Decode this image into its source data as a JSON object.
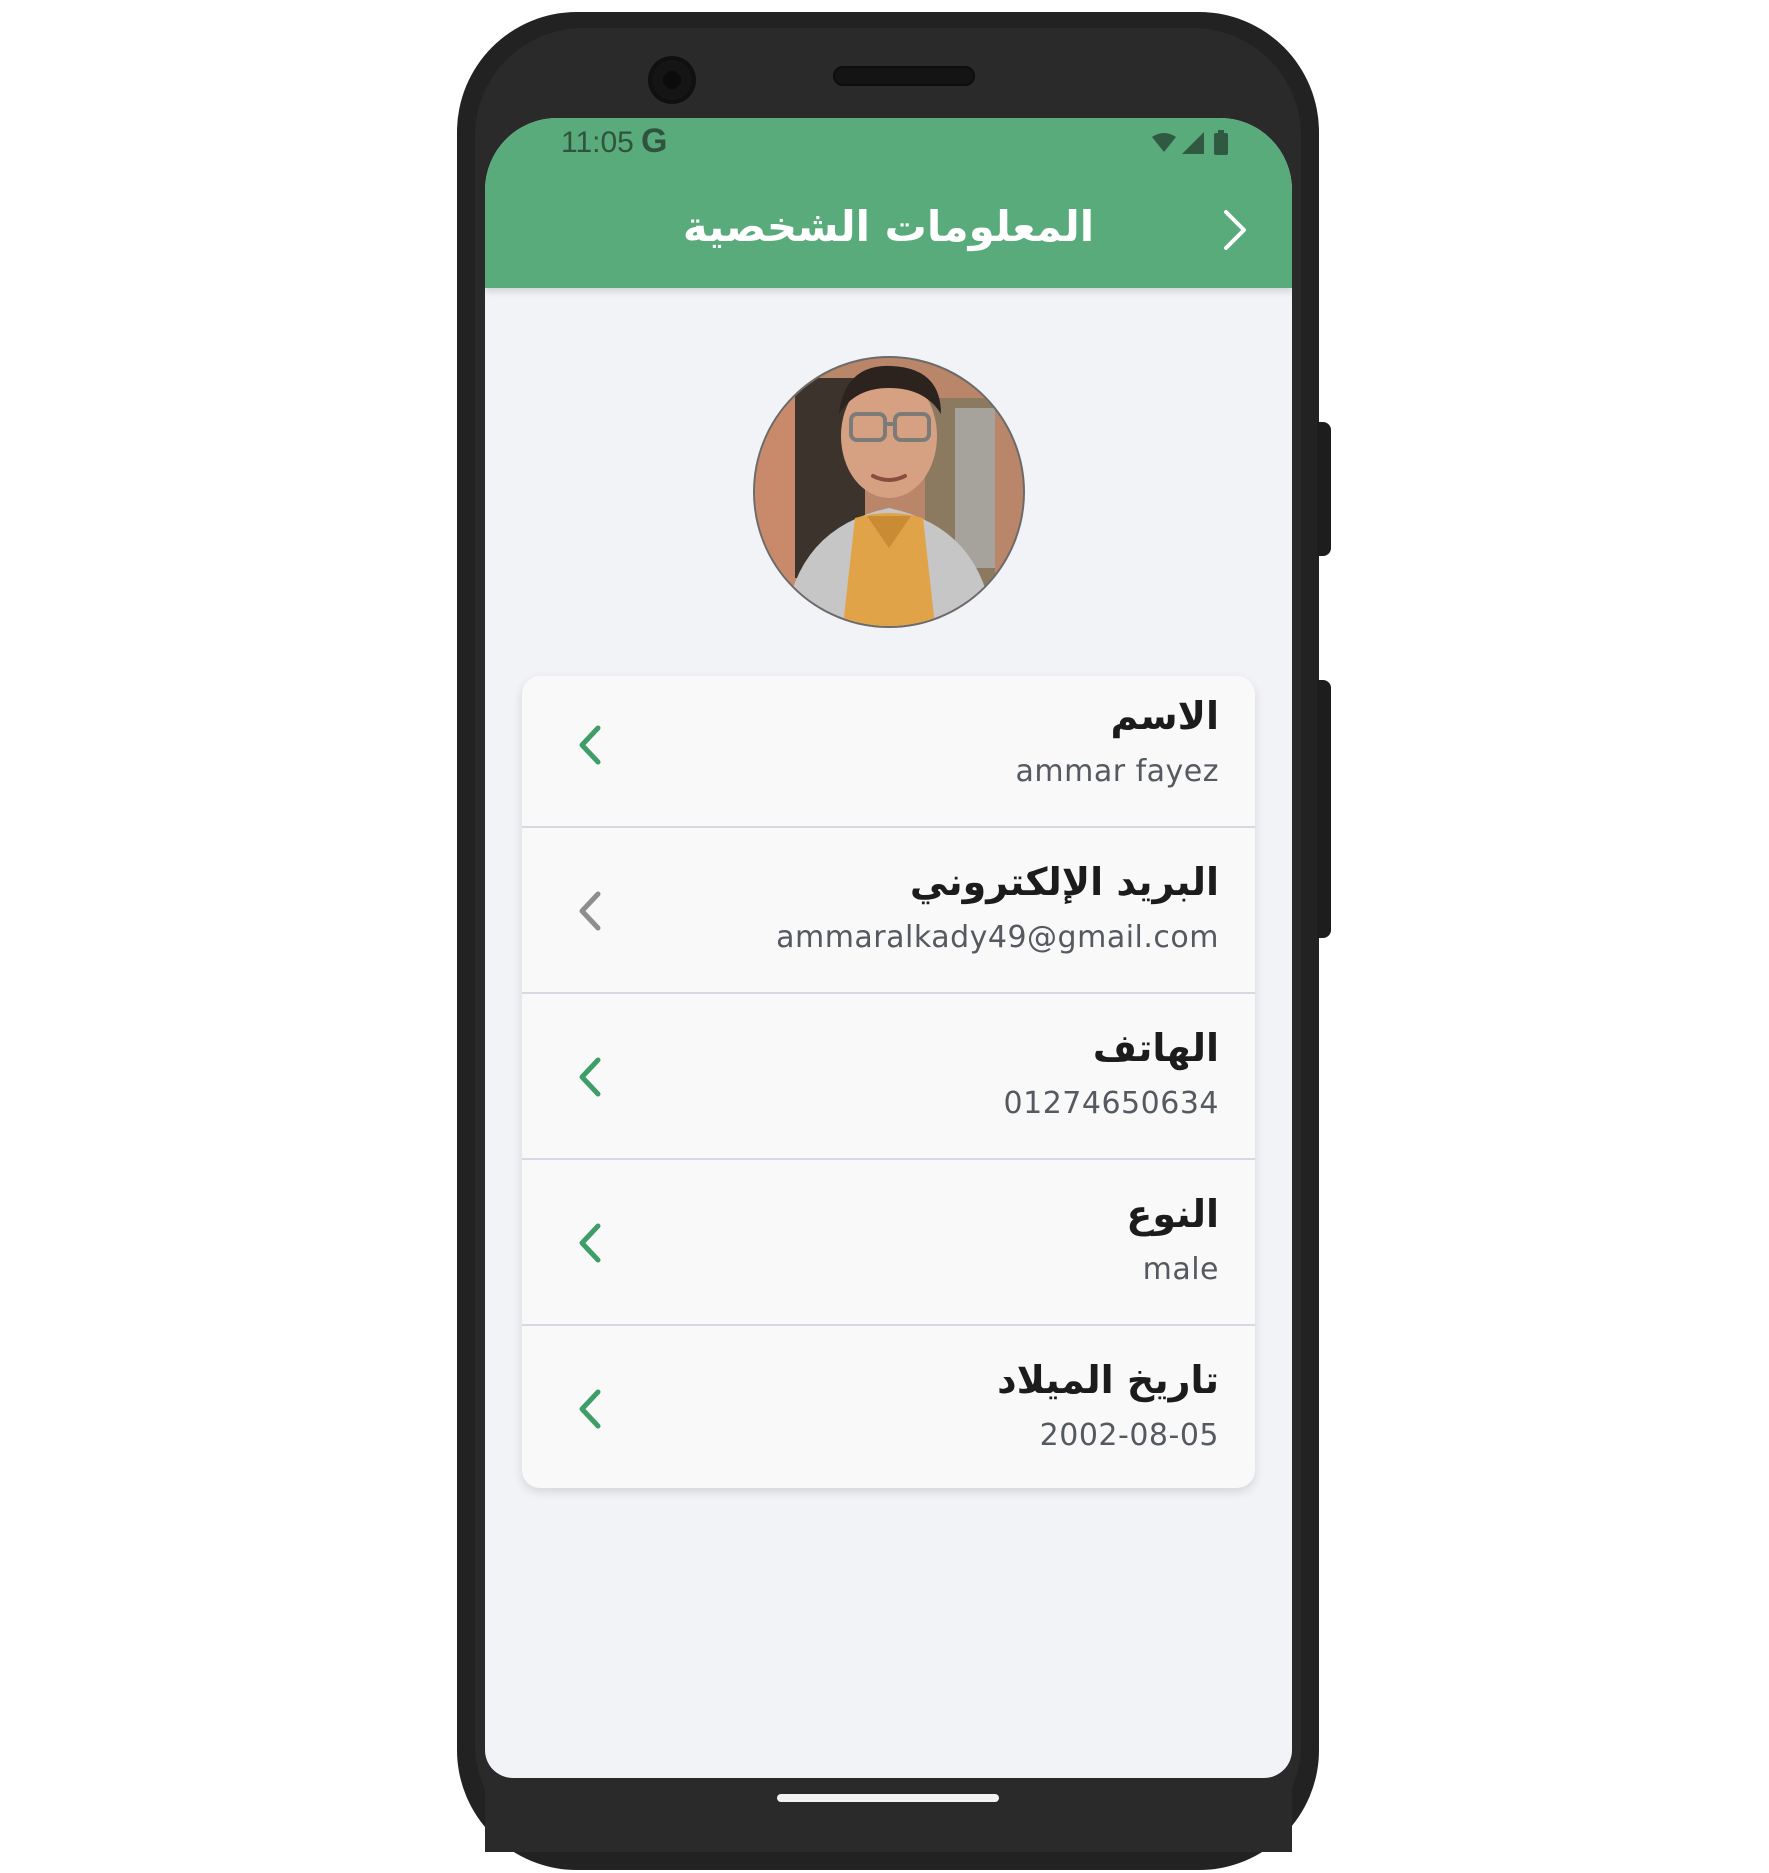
{
  "status_bar": {
    "time": "11:05",
    "g_icon_text": "G",
    "icons": [
      "wifi-icon",
      "cell-signal-icon",
      "battery-icon"
    ]
  },
  "header": {
    "title": "المعلومات الشخصية",
    "back_icon": "chevron-right-icon",
    "background_color": "#5aab7b"
  },
  "profile": {
    "avatar": "profile-photo"
  },
  "fields": [
    {
      "label": "الاسم",
      "value": "ammar fayez",
      "chevron_color": "#3f9e67"
    },
    {
      "label": "البريد الإلكتروني",
      "value": "ammaralkady49@gmail.com",
      "chevron_color": "#8e8e8e"
    },
    {
      "label": "الهاتف",
      "value": "01274650634",
      "chevron_color": "#3f9e67"
    },
    {
      "label": "النوع",
      "value": "male",
      "chevron_color": "#3f9e67"
    },
    {
      "label": "تاريخ الميلاد",
      "value": "2002-08-05",
      "chevron_color": "#3f9e67"
    }
  ],
  "colors": {
    "accent": "#5aab7b",
    "screen_background": "#f2f3f7",
    "card_background": "#f9f9fa"
  }
}
